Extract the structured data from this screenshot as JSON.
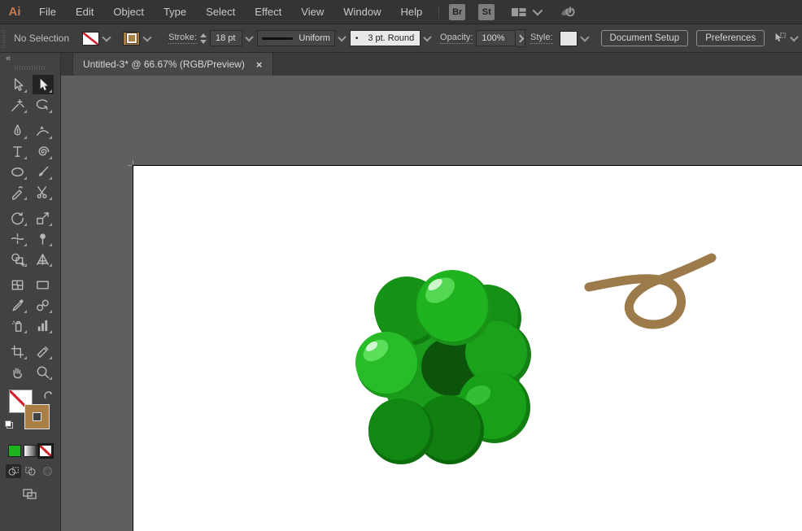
{
  "menubar": {
    "logo": "Ai",
    "items": [
      "File",
      "Edit",
      "Object",
      "Type",
      "Select",
      "Effect",
      "View",
      "Window",
      "Help"
    ],
    "bridge_button": "Br",
    "stock_button": "St",
    "icons": [
      "workspace-switcher-icon",
      "chevron-down-icon",
      "sync-power-icon"
    ]
  },
  "controlbar": {
    "selection_status": "No Selection",
    "fill_swatch": "none",
    "stroke_swatch_color": "#a97f45",
    "stroke_label": "Stroke:",
    "stroke_weight": "18 pt",
    "profile_name": "Uniform",
    "brush_bullet": "•",
    "brush_name": "3 pt. Round",
    "opacity_label": "Opacity:",
    "opacity_value": "100%",
    "style_label": "Style:",
    "document_setup_button": "Document Setup",
    "preferences_button": "Preferences",
    "icons": [
      "select-similar-icon",
      "chevron-down-icon"
    ]
  },
  "document_tab": {
    "title": "Untitled-3* @ 66.67% (RGB/Preview)",
    "name": "Untitled-3*",
    "zoom_level": "66.67%",
    "color_mode": "RGB/Preview",
    "close_glyph": "×"
  },
  "toolbar": {
    "collapse_glyph": "«",
    "active_tool": "selection-tool",
    "tools": [
      {
        "name": "direct-selection-tool"
      },
      {
        "name": "selection-tool",
        "active": true
      },
      {
        "name": "magic-wand-tool"
      },
      {
        "name": "lasso-tool"
      },
      {
        "name": "pen-tool"
      },
      {
        "name": "curvature-tool"
      },
      {
        "name": "type-tool"
      },
      {
        "name": "spiral-tool"
      },
      {
        "name": "ellipse-tool"
      },
      {
        "name": "paintbrush-tool"
      },
      {
        "name": "shaper-tool"
      },
      {
        "name": "scissors-tool"
      },
      {
        "name": "rotate-tool"
      },
      {
        "name": "scale-tool"
      },
      {
        "name": "width-tool"
      },
      {
        "name": "puppet-warp-tool"
      },
      {
        "name": "shape-builder-tool"
      },
      {
        "name": "perspective-grid-tool"
      },
      {
        "name": "mesh-tool"
      },
      {
        "name": "gradient-tool"
      },
      {
        "name": "eyedropper-tool"
      },
      {
        "name": "blend-tool"
      },
      {
        "name": "symbol-sprayer-tool"
      },
      {
        "name": "column-graph-tool"
      },
      {
        "name": "artboard-tool"
      },
      {
        "name": "slice-tool"
      },
      {
        "name": "hand-tool"
      },
      {
        "name": "zoom-tool"
      }
    ],
    "bottom_controls": [
      "fill-swatch-none",
      "stroke-swatch-brown",
      "swap-fill-stroke-icon",
      "default-fill-stroke-icon",
      "color-button-green",
      "gradient-button",
      "none-button",
      "draw-normal-mode",
      "draw-behind-mode",
      "draw-inside-mode",
      "screen-mode-button"
    ],
    "swatch_green": "#1db31d"
  },
  "artboard": {
    "artwork": [
      "grape-cluster",
      "tendril-stroke"
    ],
    "palette": {
      "grape_bright": "#1fb41f",
      "grape_mid": "#1ca11c",
      "grape_dark": "#118811",
      "grape_center": "#0c540c",
      "highlight": "#54d854",
      "shine": "#cdf6cd",
      "tendril_brown": "#9c7a4a"
    }
  },
  "colors": {
    "menubar_bg": "#343434",
    "controlbar_bg": "#3e3e3e",
    "toolbar_bg": "#424242",
    "pasteboard": "#5f5f5f",
    "logo_orange": "#c87a4a",
    "none_slash_red": "#d2232a"
  }
}
